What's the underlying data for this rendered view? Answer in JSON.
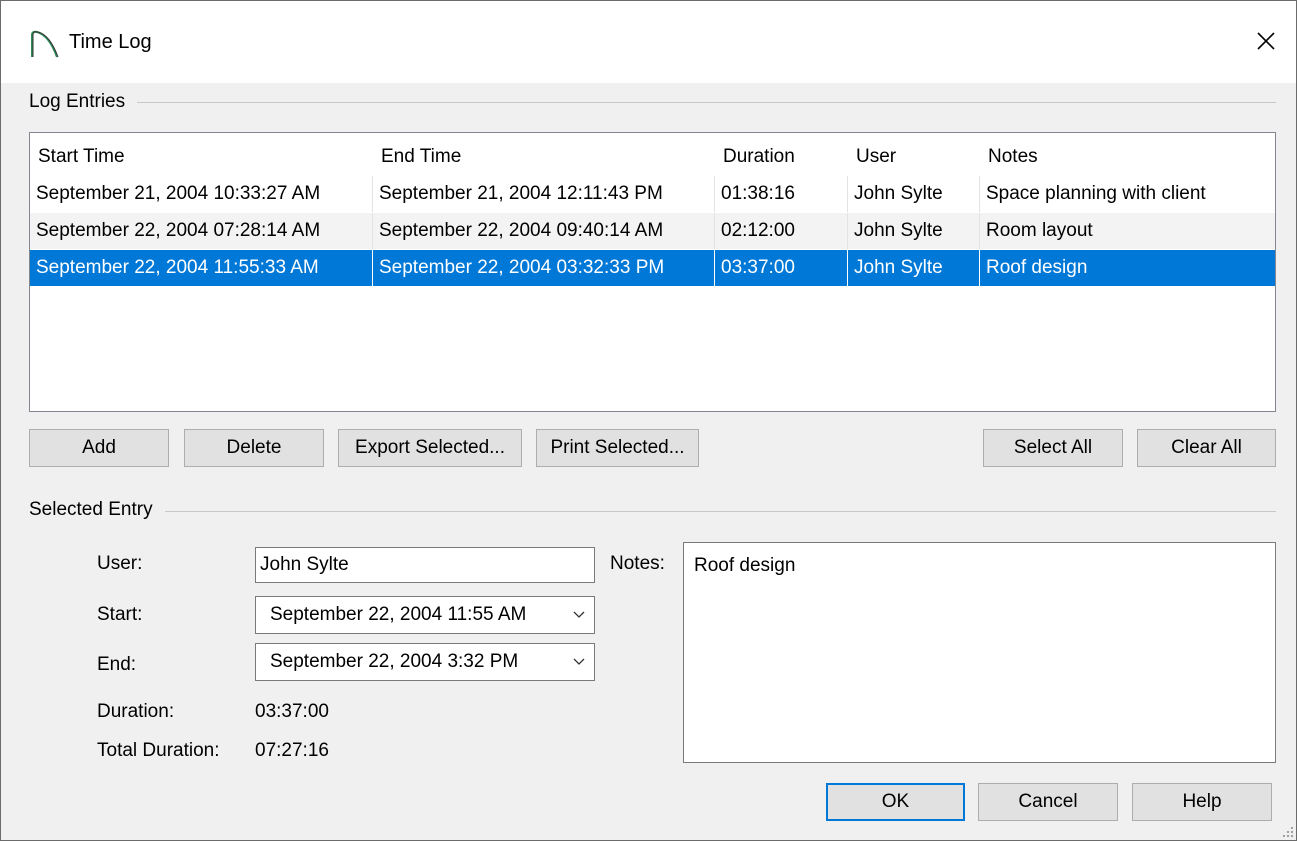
{
  "window": {
    "title": "Time Log",
    "close_glyph": "✕",
    "icon": "app-arc-icon"
  },
  "log_entries": {
    "label": "Log Entries",
    "columns": [
      "Start Time",
      "End Time",
      "Duration",
      "User",
      "Notes"
    ],
    "rows": [
      [
        "September 21, 2004 10:33:27 AM",
        "September 21, 2004 12:11:43 PM",
        "01:38:16",
        "John Sylte",
        "Space planning with client"
      ],
      [
        "September 22, 2004 07:28:14 AM",
        "September 22, 2004 09:40:14 AM",
        "02:12:00",
        "John Sylte",
        "Room layout"
      ],
      [
        "September 22, 2004 11:55:33 AM",
        "September 22, 2004 03:32:33 PM",
        "03:37:00",
        "John Sylte",
        "Roof design"
      ]
    ],
    "selected_row": 2,
    "buttons": {
      "add": "Add",
      "delete": "Delete",
      "export_selected": "Export Selected...",
      "print_selected": "Print Selected...",
      "select_all": "Select All",
      "clear_all": "Clear All"
    }
  },
  "selected_entry": {
    "label": "Selected Entry",
    "user_label": "User:",
    "user_value": "John Sylte",
    "start_label": "Start:",
    "start_value": "September 22, 2004 11:55 AM",
    "end_label": "End:",
    "end_value": "September 22, 2004 3:32 PM",
    "duration_label": "Duration:",
    "duration_value": "03:37:00",
    "total_duration_label": "Total Duration:",
    "total_duration_value": "07:27:16",
    "notes_label": "Notes:",
    "notes_value": "Roof design"
  },
  "footer": {
    "ok": "OK",
    "cancel": "Cancel",
    "help": "Help"
  },
  "colors": {
    "selection": "#0078d7",
    "dialog_bg": "#f0f0f0",
    "button_bg": "#e1e1e1"
  }
}
